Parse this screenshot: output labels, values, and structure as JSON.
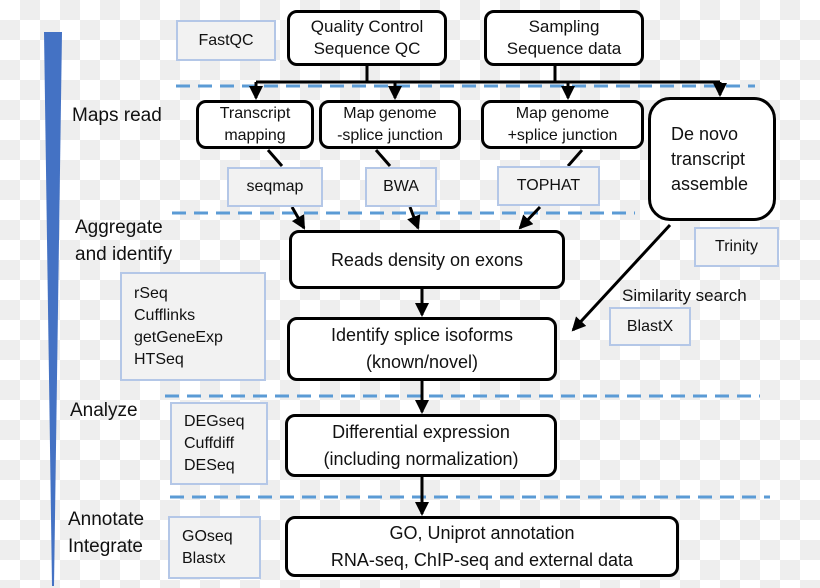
{
  "stages": {
    "maps_read": "Maps read",
    "aggregate": [
      "Aggregate",
      "and identify"
    ],
    "analyze": "Analyze",
    "annotate": [
      "Annotate",
      "Integrate"
    ]
  },
  "steps": {
    "qc": [
      "Quality Control",
      "Sequence QC"
    ],
    "sampling": [
      "Sampling",
      "Sequence data"
    ],
    "transcript_mapping": [
      "Transcript",
      "mapping"
    ],
    "map_minus": [
      "Map genome",
      "-splice junction"
    ],
    "map_plus": [
      "Map genome",
      "+splice junction"
    ],
    "denovo": [
      "De novo",
      "transcript",
      "assemble"
    ],
    "reads_density": "Reads density on exons",
    "splice_isoforms": [
      "Identify splice isoforms",
      "(known/novel)"
    ],
    "diff_expr": [
      "Differential expression",
      "(including normalization)"
    ],
    "annotation": [
      "GO, Uniprot annotation",
      "RNA-seq, ChIP-seq and external data"
    ]
  },
  "tools": {
    "fastqc": "FastQC",
    "seqmap": "seqmap",
    "bwa": "BWA",
    "tophat": "TOPHAT",
    "trinity": "Trinity",
    "blastx": "BlastX",
    "aggregate": [
      "rSeq",
      "Cufflinks",
      "getGeneExp",
      "HTSeq"
    ],
    "analyze": [
      "DEGseq",
      "Cuffdiff",
      "DESeq"
    ],
    "annotate": [
      "GOseq",
      "Blastx"
    ]
  },
  "similarity_search": "Similarity search",
  "colors": {
    "wedge": "#4472c4",
    "dash": "#5b9bd5",
    "tool_border": "#b4c7e7",
    "tool_fill": "#f2f2f2"
  }
}
